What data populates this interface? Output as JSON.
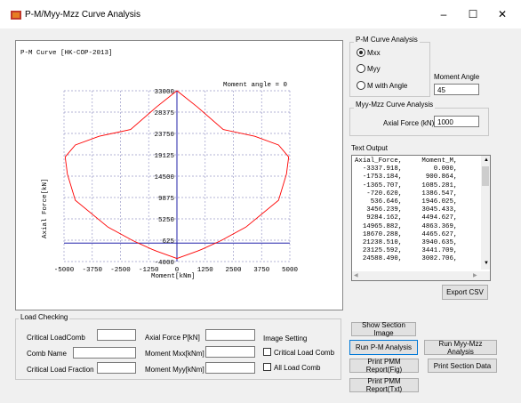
{
  "window": {
    "title": "P-M/Myy-Mzz Curve Analysis",
    "minimize": "–",
    "maximize": "☐",
    "close": "✕"
  },
  "plot": {
    "header": "P-M Curve [HK-COP-2013]",
    "angle_label": "Moment angle = 0",
    "xlabel": "Moment[kNm]",
    "ylabel": "Axial Force[kN]"
  },
  "chart_data": {
    "type": "line",
    "title": "P-M Curve [HK-COP-2013]",
    "xlabel": "Moment[kNm]",
    "ylabel": "Axial Force[kN]",
    "xlim": [
      -5000,
      5000
    ],
    "ylim": [
      -4000,
      33000
    ],
    "xticks": [
      -5000,
      -3750,
      -2500,
      -1250,
      0,
      1250,
      2500,
      3750,
      5000
    ],
    "xtick_labels": [
      "-5000",
      "-3750",
      "-2500",
      "-1250",
      "0",
      "1250",
      "2500",
      "3750",
      "5000"
    ],
    "yticks": [
      33000,
      28375,
      23750,
      19125,
      14500,
      9875,
      5250,
      625,
      -4000
    ],
    "ytick_labels": [
      "33000",
      "28375",
      "23750",
      "19125",
      "14500",
      "9875",
      "5250",
      "625",
      "-4000"
    ],
    "grid": true,
    "annotation": "Moment angle = 0",
    "series": [
      {
        "color": "#ff0000",
        "x": [
          0,
          900,
          1100,
          1950,
          3050,
          4500,
          4850,
          4950,
          4500,
          3450,
          2050,
          900,
          0,
          -900,
          -2050,
          -3450,
          -4500,
          -4950,
          -4850,
          -4500,
          -3050,
          -1950,
          -1100,
          -900,
          0
        ],
        "y": [
          -3338,
          -1753,
          -1366,
          536,
          3456,
          9284,
          14966,
          18670,
          21238,
          23126,
          24589,
          29500,
          33000,
          29500,
          24589,
          23126,
          21238,
          18670,
          14966,
          9284,
          3456,
          536,
          -1366,
          -1753,
          -3338
        ]
      }
    ]
  },
  "pm_group": {
    "title": "P-M Curve Analysis",
    "options": [
      "Mxx",
      "Myy",
      "M with Angle"
    ],
    "selected": "Mxx",
    "moment_angle_label": "Moment Angle",
    "moment_angle_value": "45"
  },
  "myy_group": {
    "title": "Myy-Mzz Curve Analysis",
    "axial_label": "Axial Force (kN)",
    "axial_value": "1000"
  },
  "text_output": {
    "label": "Text Output",
    "content": "Axial_Force,     Moment_M,\n  -3337.918,        0.000,\n  -1753.184,      900.864,\n  -1365.707,     1085.281,\n   -720.620,     1386.547,\n    536.646,     1946.025,\n   3456.239,     3045.433,\n   9284.162,     4494.627,\n  14965.882,     4863.369,\n  18670.288,     4465.627,\n  21238.510,     3940.635,\n  23125.592,     3441.709,\n  24588.490,     3002.706,"
  },
  "export_csv": "Export CSV",
  "load_checking": {
    "title": "Load Checking",
    "critical_loadcomb": "Critical LoadComb",
    "comb_name": "Comb Name",
    "critical_load_fraction": "Critical Load Fraction",
    "axial_force": "Axial Force P[kN]",
    "moment_mxx": "Moment Mxx[kNm]",
    "moment_myy": "Moment Myy[kNm]",
    "image_setting": "Image Setting",
    "critical_load_comb": "Critical Load Comb",
    "all_load_comb": "All Load Comb"
  },
  "buttons": {
    "show_section_image": "Show Section Image",
    "run_pm": "Run P-M Analysis",
    "run_myy": "Run Myy-Mzz Analysis",
    "print_pmm_fig": "Print PMM Report(Fig)",
    "print_section_data": "Print Section Data",
    "print_pmm_txt": "Print PMM Report(Txt)"
  }
}
